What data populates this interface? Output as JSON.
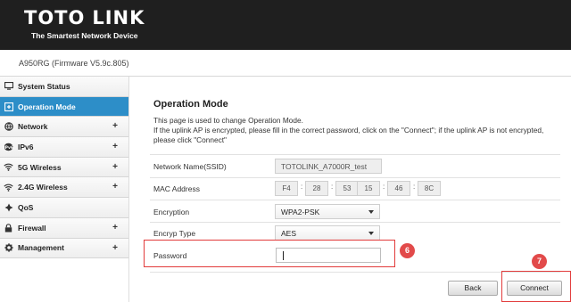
{
  "header": {
    "logo_left": "TOTO",
    "logo_right": "LINK",
    "tagline": "The Smartest Network Device"
  },
  "firmware": "A950RG (Firmware V5.9c.805)",
  "sidebar": {
    "items": [
      {
        "label": "System Status",
        "icon": "monitor-icon",
        "plus": ""
      },
      {
        "label": "Operation Mode",
        "icon": "operation-icon",
        "plus": ""
      },
      {
        "label": "Network",
        "icon": "globe-icon",
        "plus": "+"
      },
      {
        "label": "IPv6",
        "icon": "ipv6-icon",
        "plus": "+"
      },
      {
        "label": "5G Wireless",
        "icon": "wifi-icon",
        "plus": "+"
      },
      {
        "label": "2.4G Wireless",
        "icon": "wifi-icon",
        "plus": "+"
      },
      {
        "label": "QoS",
        "icon": "qos-icon",
        "plus": ""
      },
      {
        "label": "Firewall",
        "icon": "lock-icon",
        "plus": "+"
      },
      {
        "label": "Management",
        "icon": "gear-icon",
        "plus": "+"
      }
    ]
  },
  "main": {
    "title": "Operation Mode",
    "desc1": "This page is used to change Operation Mode.",
    "desc2": "If the uplink AP is encrypted, please fill in the correct password, click on the \"Connect\"; if the uplink AP is not encrypted, please click \"Connect\"",
    "form": {
      "ssid_label": "Network Name(SSID)",
      "ssid_value": "TOTOLINK_A7000R_test",
      "mac_label": "MAC Address",
      "mac": [
        "F4",
        "28",
        "53",
        "15",
        "46",
        "8C"
      ],
      "encryption_label": "Encryption",
      "encryption_value": "WPA2-PSK",
      "encryp_type_label": "Encryp Type",
      "encryp_type_value": "AES",
      "password_label": "Password",
      "password_value": ""
    },
    "buttons": {
      "back": "Back",
      "connect": "Connect"
    },
    "annotations": {
      "step6": "6",
      "step7": "7"
    }
  },
  "colors": {
    "header_bg": "#1f1f1f",
    "active_nav": "#2d8ec8",
    "highlight": "#e23b3b"
  }
}
